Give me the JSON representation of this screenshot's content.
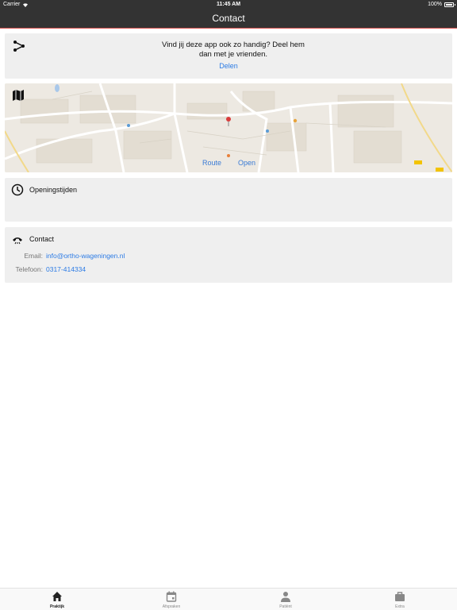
{
  "status_bar": {
    "carrier": "Carrier",
    "time": "11:45 AM",
    "battery": "100%"
  },
  "nav": {
    "title": "Contact"
  },
  "share": {
    "text": "Vind jij deze app ook zo handig? Deel hem dan met je vrienden.",
    "link": "Delen"
  },
  "map": {
    "route_label": "Route",
    "open_label": "Open"
  },
  "hours": {
    "title": "Openingstijden"
  },
  "contact": {
    "title": "Contact",
    "email_label": "Email:",
    "email_value": "info@ortho-wageningen.nl",
    "phone_label": "Telefoon:",
    "phone_value": "0317-414334"
  },
  "tabs": [
    {
      "label": "Praktijk",
      "icon": "home-icon",
      "active": true
    },
    {
      "label": "Afspraken",
      "icon": "calendar-icon",
      "active": false
    },
    {
      "label": "Patiënt",
      "icon": "person-icon",
      "active": false
    },
    {
      "label": "Extra",
      "icon": "briefcase-icon",
      "active": false
    }
  ],
  "colors": {
    "bar": "#333333",
    "accent_line": "#d9534f",
    "link": "#2c7be5",
    "card_bg": "#efefef"
  }
}
